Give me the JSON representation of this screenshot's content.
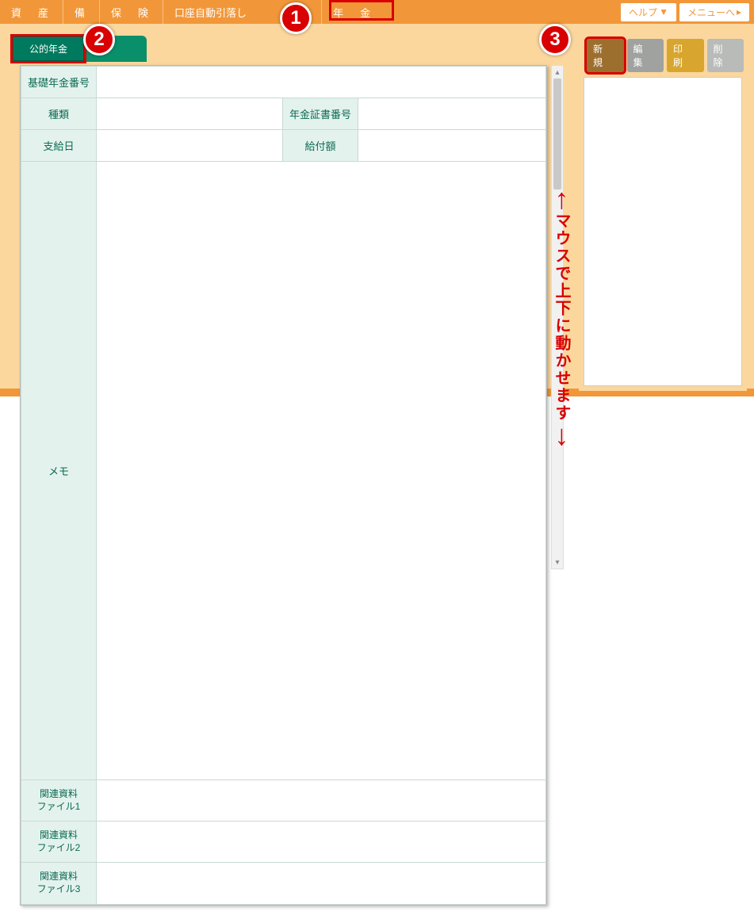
{
  "nav": {
    "items": [
      "資　産",
      "備",
      "保　険",
      "口座自動引落し",
      "年　金"
    ],
    "help": "ヘルプ",
    "menu": "メニューへ"
  },
  "subTab": {
    "label": "公的年金"
  },
  "form": {
    "basicNumberLabel": "基礎年金番号",
    "basicNumberValue": "",
    "typeLabel": "種類",
    "typeValue": "",
    "certLabel": "年金証書番号",
    "certValue": "",
    "payDayLabel": "支給日",
    "payDayValue": "",
    "amountLabel": "給付額",
    "amountValue": "",
    "memoLabel": "メモ",
    "memoValue": "",
    "file1Label": "関連資料\nファイル1",
    "file2Label": "関連資料\nファイル2",
    "file3Label": "関連資料\nファイル3"
  },
  "actions": {
    "new": "新 規",
    "edit": "編 集",
    "print": "印 刷",
    "delete": "削 除"
  },
  "callouts": {
    "one": "1",
    "two": "2",
    "three": "3"
  },
  "annotation": {
    "arrowUp": "↑",
    "text": "マウスで上下に動かせます",
    "arrowDown": "↓"
  },
  "scrollbar": {
    "up": "▴",
    "down": "▾"
  }
}
